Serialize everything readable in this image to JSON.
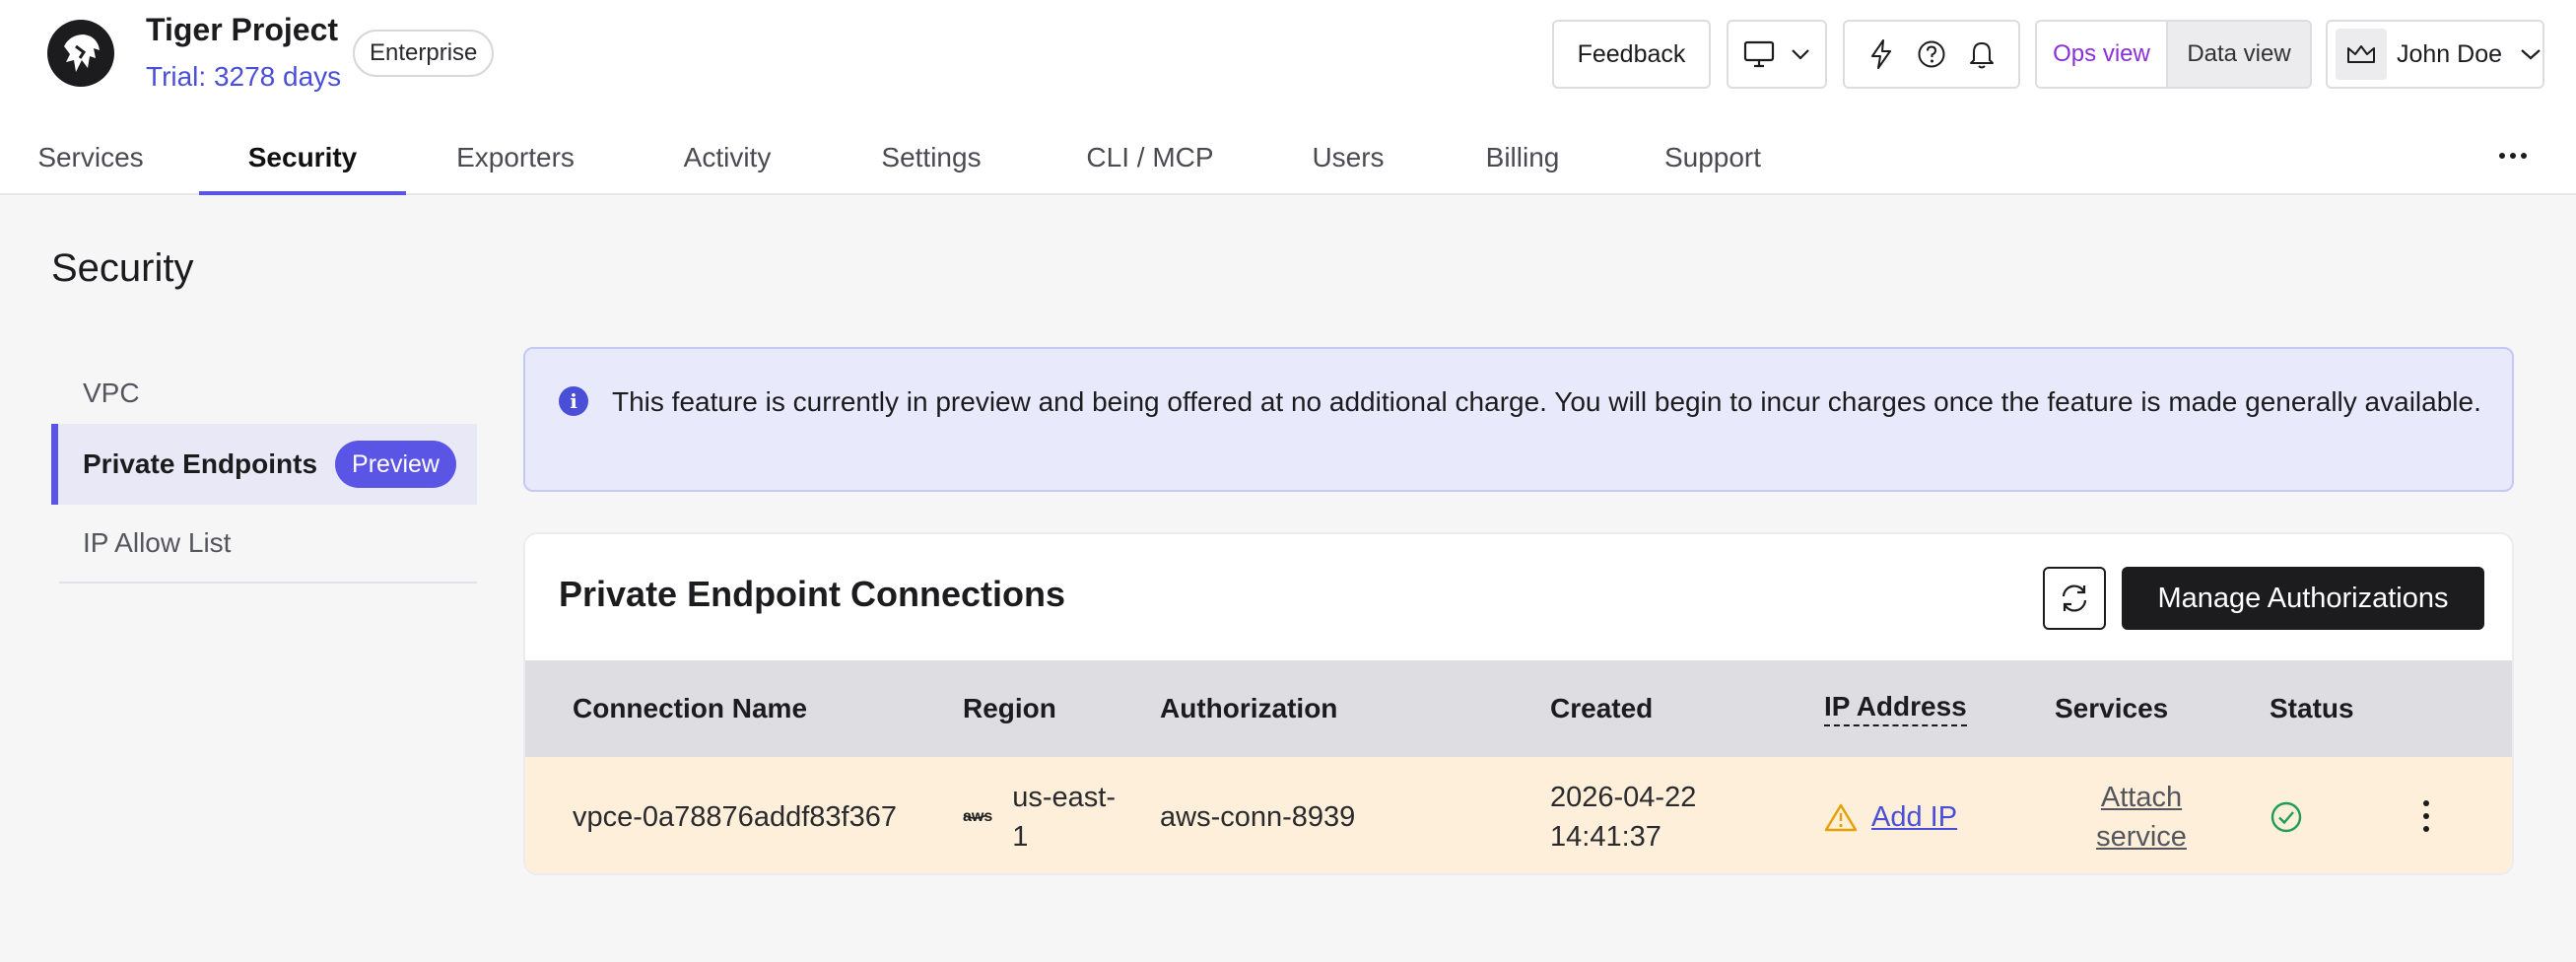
{
  "project": {
    "title": "Tiger Project",
    "trial": "Trial: 3278 days",
    "plan_badge": "Enterprise"
  },
  "header": {
    "feedback_label": "Feedback",
    "view_toggle": {
      "ops": "Ops view",
      "data": "Data view",
      "selected": "Ops view"
    },
    "user_name": "John Doe",
    "icons": [
      "monitor-icon",
      "chevron-down-icon",
      "lightning-icon",
      "help-icon",
      "bell-icon",
      "crown-icon"
    ]
  },
  "tabs": [
    {
      "label": "Services"
    },
    {
      "label": "Security",
      "active": true
    },
    {
      "label": "Exporters"
    },
    {
      "label": "Activity"
    },
    {
      "label": "Settings"
    },
    {
      "label": "CLI / MCP"
    },
    {
      "label": "Users"
    },
    {
      "label": "Billing"
    },
    {
      "label": "Support"
    }
  ],
  "page": {
    "title": "Security"
  },
  "sidenav": {
    "items": [
      {
        "label": "VPC"
      },
      {
        "label": "Private Endpoints",
        "active": true,
        "badge": "Preview"
      },
      {
        "label": "IP Allow List"
      }
    ]
  },
  "banner": {
    "text": "This feature is currently in preview and being offered at no additional charge. You will begin to incur charges once the feature is made generally available."
  },
  "connections": {
    "title": "Private Endpoint Connections",
    "manage_label": "Manage Authorizations",
    "columns": [
      "Connection Name",
      "Region",
      "Authorization",
      "Created",
      "IP Address",
      "Services",
      "Status"
    ],
    "rows": [
      {
        "name": "vpce-0a78876addf83f367",
        "provider": "aws",
        "region": "us-east-1",
        "authorization": "aws-conn-8939",
        "created": "2026-04-22 14:41:37",
        "ip_action": "Add IP",
        "services_action": "Attach service",
        "status": "ok"
      }
    ]
  },
  "colors": {
    "accent": "#5b55e6",
    "link": "#4b4fd8",
    "ops_view": "#8b2fd6",
    "row_highlight": "#fdefd9",
    "warning": "#e5a000",
    "success": "#1f9d55"
  }
}
